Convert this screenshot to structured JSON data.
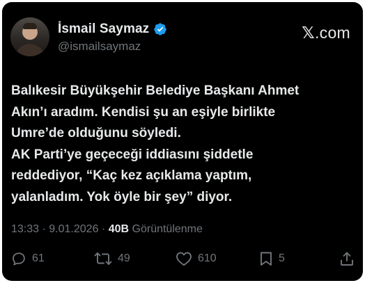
{
  "author": {
    "name": "İsmail Saymaz",
    "handle": "@ismailsaymaz",
    "verified": true
  },
  "site": {
    "logo_letter": "𝕏",
    "logo_suffix": ".com"
  },
  "tweet": {
    "lines": [
      "Balıkesir Büyükşehir Belediye Başkanı Ahmet",
      "Akın’ı aradım. Kendisi şu an eşiyle birlikte",
      "Umre’de olduğunu söyledi.",
      "AK Parti’ye geçeceği iddiasını şiddetle",
      "reddediyor, “Kaç kez açıklama yaptım,",
      "yalanladım. Yok öyle bir şey” diyor."
    ],
    "time": "13:33",
    "separator1": "·",
    "date": "9.01.2026",
    "separator2": "·",
    "views": "40B",
    "views_label": "Görüntülenme"
  },
  "actions": {
    "replies": "61",
    "reposts": "49",
    "likes": "610",
    "bookmarks": "5"
  },
  "colors": {
    "background": "#000000",
    "text": "#e7e9ea",
    "muted": "#71767b",
    "verified": "#1d9bf0"
  },
  "icons": [
    "verified-badge-icon",
    "reply-icon",
    "repost-icon",
    "like-icon",
    "bookmark-icon",
    "share-icon"
  ]
}
